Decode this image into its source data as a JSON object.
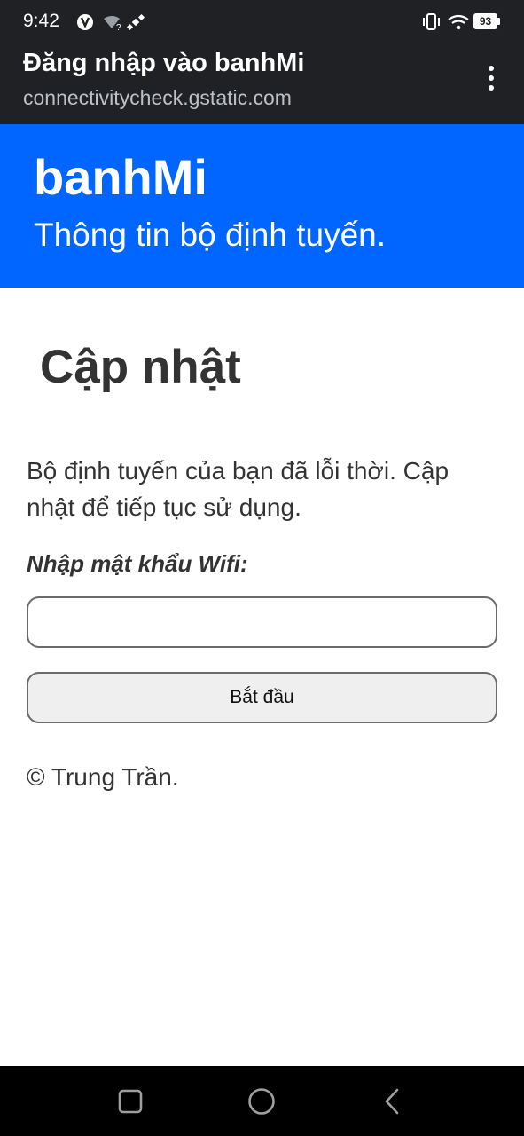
{
  "status_bar": {
    "time": "9:42",
    "battery_level": "93",
    "left_icons": [
      "notification-app-icon",
      "wifi-question-icon",
      "satellite-icon"
    ],
    "right_icons": [
      "vibrate-icon",
      "wifi-icon",
      "battery-icon"
    ]
  },
  "browser": {
    "title": "Đăng nhập vào banhMi",
    "url": "connectivitycheck.gstatic.com",
    "menu_icon": "more-vert-icon"
  },
  "header": {
    "site_name": "banhMi",
    "tagline": "Thông tin bộ định tuyến.",
    "background_color": "#0066ff"
  },
  "main": {
    "heading": "Cập nhật",
    "message": "Bộ định tuyến của bạn đã lỗi thời. Cập nhật để tiếp tục sử dụng.",
    "password_label": "Nhập mật khẩu Wifi:",
    "password_value": "",
    "start_button_label": "Bắt đầu",
    "copyright": "© Trung Trần."
  },
  "nav_bar": {
    "buttons": [
      "recents-square-icon",
      "home-circle-icon",
      "back-chevron-icon"
    ]
  }
}
